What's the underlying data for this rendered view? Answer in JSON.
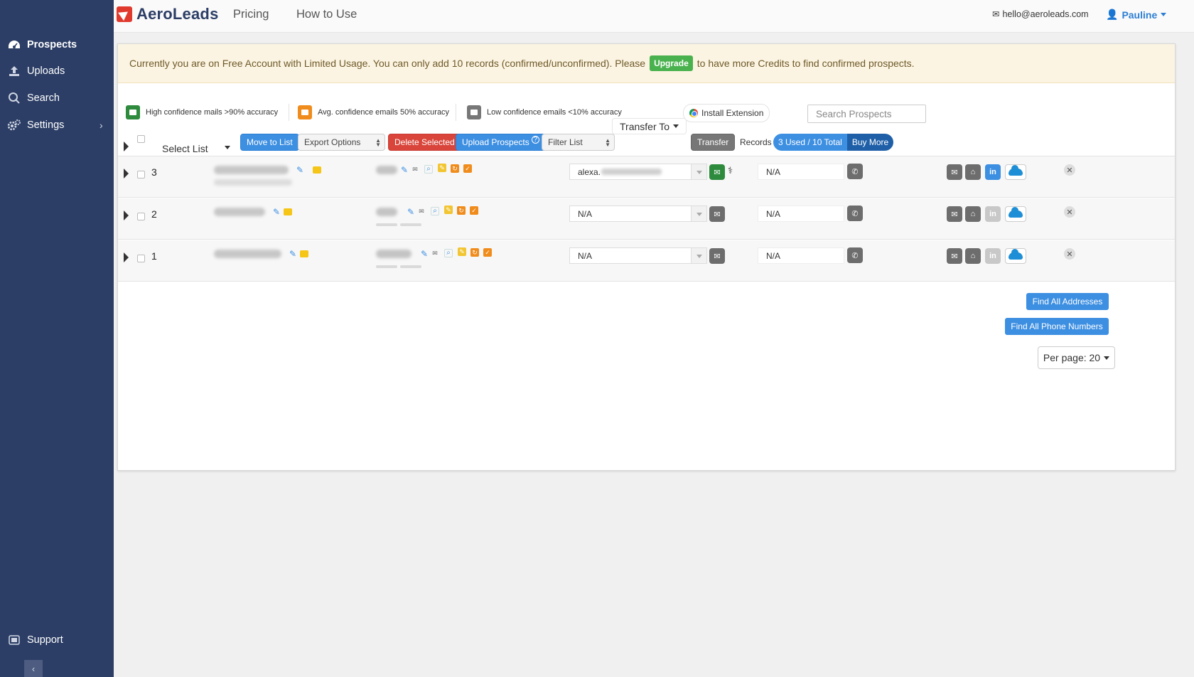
{
  "sidebar": {
    "items": [
      {
        "label": "Prospects",
        "icon": "dashboard-icon"
      },
      {
        "label": "Uploads",
        "icon": "upload-icon"
      },
      {
        "label": "Search",
        "icon": "search-icon"
      },
      {
        "label": "Settings",
        "icon": "gear-icon"
      }
    ],
    "support_label": "Support",
    "collapse_symbol": "‹"
  },
  "topbar": {
    "brand": "AeroLeads",
    "nav": [
      "Pricing",
      "How to Use"
    ],
    "email": "hello@aeroleads.com",
    "user": "Pauline"
  },
  "alert": {
    "text_before": "Currently you are on Free Account with Limited Usage. You can only add 10 records (confirmed/unconfirmed). Please",
    "upgrade_label": "Upgrade",
    "text_after": "to have more Credits to find confirmed prospects."
  },
  "legend": [
    {
      "label": "High confidence mails >90% accuracy",
      "color": "#2e8b3d"
    },
    {
      "label": "Avg. confidence emails 50% accuracy",
      "color": "#f08c1c"
    },
    {
      "label": "Low confidence emails <10% accuracy",
      "color": "#777777"
    }
  ],
  "install_extension": "Install Extension",
  "search": {
    "placeholder": "Search Prospects"
  },
  "toolbar": {
    "select_list": "Select List",
    "move_to_list": "Move to List",
    "export_options": "Export Options",
    "delete_selected": "Delete Selected",
    "upload_prospects": "Upload Prospects",
    "filter_list": "Filter List",
    "transfer_to": "Transfer To",
    "transfer": "Transfer",
    "records": "Records",
    "usage": "3 Used / 10 Total",
    "buy_more": "Buy More"
  },
  "rows": [
    {
      "num": "3",
      "name": "",
      "company": "",
      "email": "alexa.",
      "phone": "N/A",
      "linkedin_active": true,
      "email_status": "green"
    },
    {
      "num": "2",
      "name": "",
      "company": "",
      "email": "N/A",
      "phone": "N/A",
      "linkedin_active": false,
      "email_status": "gray"
    },
    {
      "num": "1",
      "name": "",
      "company": "",
      "email": "N/A",
      "phone": "N/A",
      "linkedin_active": false,
      "email_status": "gray"
    }
  ],
  "actions": {
    "find_addresses": "Find All Addresses",
    "find_phones": "Find All Phone Numbers",
    "per_page": "Per page: 20"
  },
  "colors": {
    "sidebar": "#2c3e66",
    "accent": "#3d8fe2",
    "danger": "#d9453b",
    "success": "#49b24e"
  }
}
